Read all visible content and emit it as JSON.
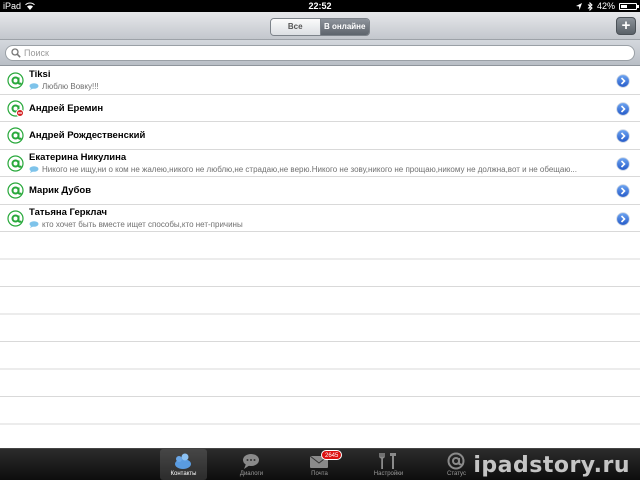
{
  "status_bar": {
    "carrier": "iPad",
    "time": "22:52",
    "battery": "42%",
    "battery_level": 0.42
  },
  "segments": {
    "all": "Все",
    "online": "В онлайне",
    "selected": "online"
  },
  "toolbar": {
    "add_label": "+"
  },
  "search": {
    "placeholder": "Поиск",
    "value": ""
  },
  "contacts": [
    {
      "name": "Tiksi",
      "status": "Люблю Вовку!!!",
      "presence": "online"
    },
    {
      "name": "Андрей Еремин",
      "status": "",
      "presence": "busy"
    },
    {
      "name": "Андрей Рождественский",
      "status": "",
      "presence": "online"
    },
    {
      "name": "Екатерина Никулина",
      "status": "Никого не ищу,ни о ком не жалею,никого не люблю,не страдаю,не верю.Никого не зову,никого не прощаю,никому не должна,вот и не обещаю...",
      "presence": "online"
    },
    {
      "name": "Марик Дубов",
      "status": "",
      "presence": "online"
    },
    {
      "name": "Татьяна Герклач",
      "status": "кто хочет быть вместе ищет способы,кто нет-причины",
      "presence": "online"
    }
  ],
  "tabs": [
    {
      "label": "Контакты",
      "icon": "contacts-icon",
      "active": true
    },
    {
      "label": "Диалоги",
      "icon": "dialogs-icon",
      "active": false
    },
    {
      "label": "Почта",
      "icon": "mail-icon",
      "active": false,
      "badge": "2645"
    },
    {
      "label": "Настройки",
      "icon": "settings-icon",
      "active": false
    },
    {
      "label": "Статус",
      "icon": "status-icon",
      "active": false
    }
  ],
  "watermark": "ipadstory.ru",
  "colors": {
    "online": "#27a83a",
    "busy": "#d42020",
    "accent": "#3b6fd8"
  }
}
